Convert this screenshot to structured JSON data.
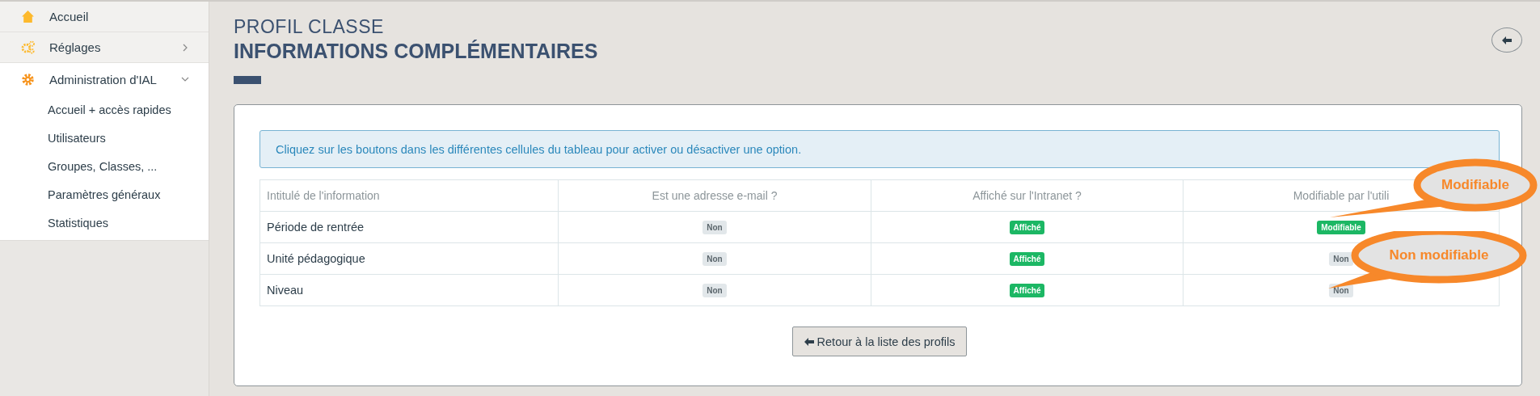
{
  "sidebar": {
    "items": [
      {
        "label": "Accueil",
        "expandable": false,
        "expanded": false
      },
      {
        "label": "Réglages",
        "expandable": true,
        "expanded": false
      },
      {
        "label": "Administration d'IAL",
        "expandable": true,
        "expanded": true,
        "children": [
          {
            "label": "Accueil + accès rapides"
          },
          {
            "label": "Utilisateurs"
          },
          {
            "label": "Groupes, Classes, ..."
          },
          {
            "label": "Paramètres généraux"
          },
          {
            "label": "Statistiques"
          }
        ]
      }
    ]
  },
  "header": {
    "subtitle": "PROFIL CLASSE",
    "title": "INFORMATIONS COMPLÉMENTAIRES"
  },
  "alert": "Cliquez sur les boutons dans les différentes cellules du tableau pour activer ou désactiver une option.",
  "table": {
    "columns": [
      "Intitulé de l'information",
      "Est une adresse e-mail ?",
      "Affiché sur l'Intranet ?",
      "Modifiable par l'utili"
    ],
    "rows": [
      {
        "cells": [
          {
            "text": "Période de rentrée"
          },
          {
            "text": "Non",
            "on": false
          },
          {
            "text": "Affiché",
            "on": true
          },
          {
            "text": "Modifiable",
            "on": true
          }
        ]
      },
      {
        "cells": [
          {
            "text": "Unité pédagogique"
          },
          {
            "text": "Non",
            "on": false
          },
          {
            "text": "Affiché",
            "on": true
          },
          {
            "text": "Non",
            "on": false
          }
        ]
      },
      {
        "cells": [
          {
            "text": "Niveau"
          },
          {
            "text": "Non",
            "on": false
          },
          {
            "text": "Affiché",
            "on": true
          },
          {
            "text": "Non",
            "on": false
          }
        ]
      }
    ]
  },
  "back_button": "Retour à la liste des profils",
  "callouts": [
    {
      "text": "Modifiable"
    },
    {
      "text": "Non modifiable"
    }
  ]
}
